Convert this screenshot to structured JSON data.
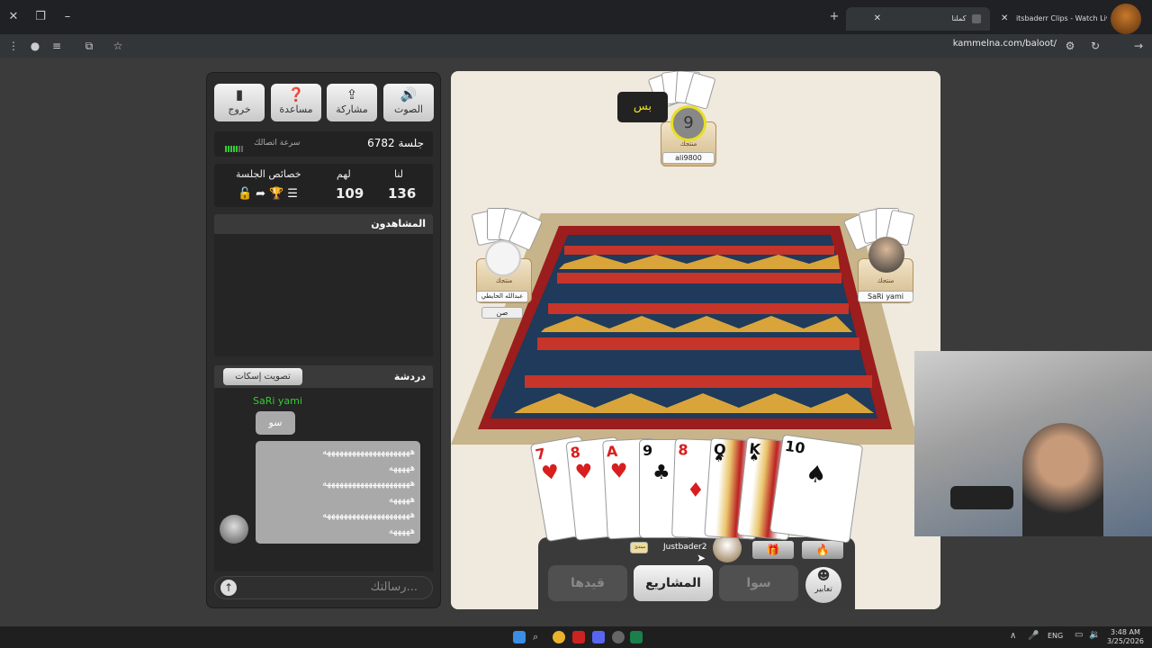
{
  "browser": {
    "tabs": [
      {
        "title": "كملنا"
      },
      {
        "title": "itsbaderr Clips - Watch Live on"
      }
    ],
    "url": "kammelna.com/baloot/"
  },
  "sidebar": {
    "buttons": [
      {
        "label": "خروج",
        "icon": "exit-icon"
      },
      {
        "label": "مساعدة",
        "icon": "help-icon"
      },
      {
        "label": "مشاركة",
        "icon": "share-icon"
      },
      {
        "label": "الصوت",
        "icon": "sound-icon"
      }
    ],
    "session": "جلسة 6782",
    "connection_label": "سرعة اتصالك",
    "score": {
      "us_label": "لنا",
      "them_label": "لهم",
      "props_label": "خصائص الجلسة",
      "us": "136",
      "them": "109"
    },
    "watchers_title": "المشاهدون",
    "chat_title": "دردشة",
    "mute_vote": "تصويت إسكات",
    "chat": {
      "sender": "SaRi yami",
      "msg1": "سو",
      "msg2_lines": [
        "هههههههههههههههههههههه",
        "هههههه",
        "هههههههههههههههههههههه",
        "هههههه",
        "هههههههههههههههههههههه",
        "هههههه"
      ]
    },
    "message_placeholder": "رسالتك..."
  },
  "game": {
    "bid_bubble": "بس",
    "top_player": {
      "name": "ali9800",
      "status": "منتجك",
      "timer": "9"
    },
    "left_player": {
      "name": "عبدالله الحايطي",
      "status": "منتجك",
      "bid": "صن"
    },
    "right_player": {
      "name": "SaRi yami",
      "status": "منتجك"
    },
    "me": {
      "name": "Justbader2",
      "badge": "مبتدئ"
    },
    "hand": [
      {
        "rank": "7",
        "suit": "♥",
        "color": "red"
      },
      {
        "rank": "8",
        "suit": "♥",
        "color": "red"
      },
      {
        "rank": "A",
        "suit": "♥",
        "color": "red"
      },
      {
        "rank": "9",
        "suit": "♣",
        "color": "black"
      },
      {
        "rank": "8",
        "suit": "♦",
        "color": "red"
      },
      {
        "rank": "Q",
        "suit": "♠",
        "color": "black"
      },
      {
        "rank": "K",
        "suit": "♠",
        "color": "black"
      },
      {
        "rank": "10",
        "suit": "♠",
        "color": "black"
      }
    ],
    "actions": {
      "restrictions": "قيدها",
      "projects": "المشاريع",
      "sawa": "سوا",
      "emotes": "تعابير"
    }
  },
  "taskbar": {
    "lang": "ENG",
    "time": "3:48 AM",
    "date": "3/25/2026"
  }
}
